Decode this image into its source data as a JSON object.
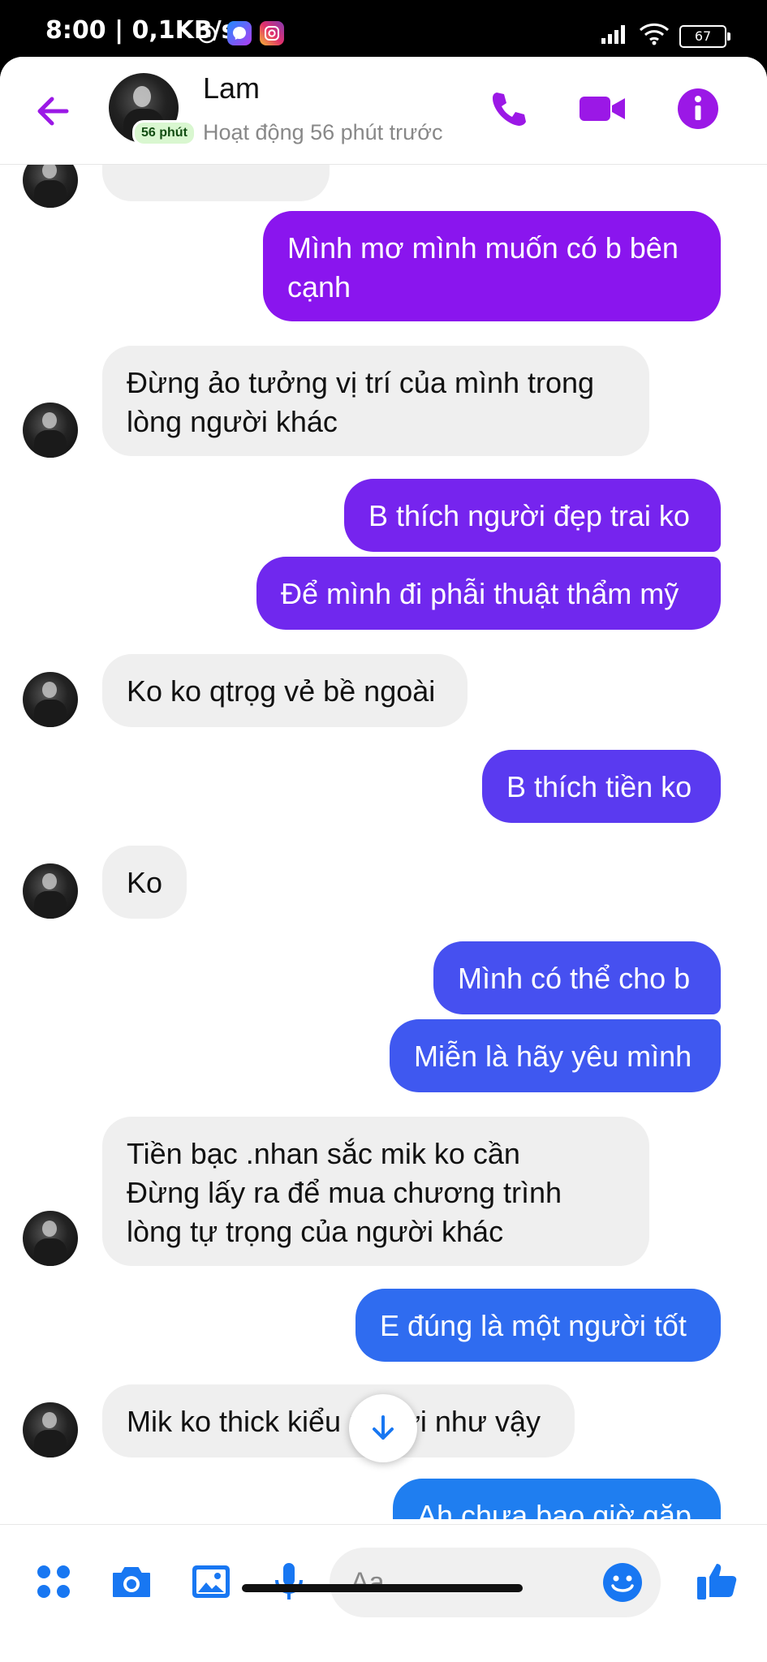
{
  "status_bar": {
    "time": "8:00 | 0,1KB/s",
    "battery": "67"
  },
  "header": {
    "contact_name": "Lam",
    "active_badge": "56 phút",
    "status": "Hoạt động 56 phút trước"
  },
  "messages": [
    {
      "from": "me",
      "text": "Mình mơ  mình muốn có b bên cạnh",
      "color": "#8a15ee"
    },
    {
      "from": "them",
      "text": "Đừng ảo tưởng vị trí của mình trong lòng người khác"
    },
    {
      "from": "me",
      "text": "B thích người đẹp trai ko",
      "color": "#7624ee"
    },
    {
      "from": "me",
      "text": "Để mình đi phẫi thuật thẩm mỹ",
      "color": "#7028ee"
    },
    {
      "from": "them",
      "text": "Ko ko qtrọg vẻ bề ngoài"
    },
    {
      "from": "me",
      "text": "B thích tiền ko",
      "color": "#5a3af0"
    },
    {
      "from": "them",
      "text": "Ko"
    },
    {
      "from": "me",
      "text": "Mình có thể cho b",
      "color": "#4650f0"
    },
    {
      "from": "me",
      "text": "Miễn là hãy yêu mình",
      "color": "#3f58f0"
    },
    {
      "from": "them",
      "text": "Tiền bạc .nhan sắc mik ko cần\nĐừng lấy ra để mua chương trình lòng tự trọng của người khác"
    },
    {
      "from": "me",
      "text": "E đúng là một người tốt",
      "color": "#2f6cf0"
    },
    {
      "from": "them",
      "text": "Mik ko thick kiểu người như vậy"
    },
    {
      "from": "me",
      "text": "Ah chưa bao giờ gặp",
      "color": "#1f7ef0"
    }
  ],
  "composer": {
    "placeholder": "Aa"
  },
  "colors": {
    "accent_purple": "#9b18e6",
    "accent_blue": "#1877f2"
  }
}
